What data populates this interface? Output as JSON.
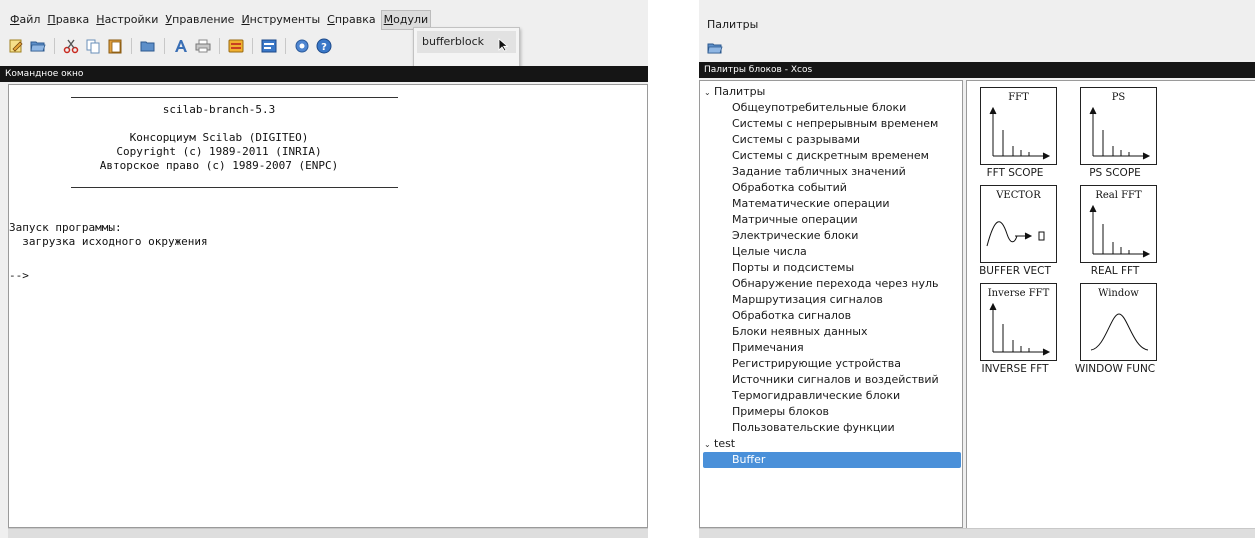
{
  "console_window": {
    "menu": [
      {
        "label": "Файл",
        "mnemonic": "Ф"
      },
      {
        "label": "Правка",
        "mnemonic": "П"
      },
      {
        "label": "Настройки",
        "mnemonic": "Н"
      },
      {
        "label": "Управление",
        "mnemonic": "У"
      },
      {
        "label": "Инструменты",
        "mnemonic": "И"
      },
      {
        "label": "Справка",
        "mnemonic": "С"
      },
      {
        "label": "Модули",
        "mnemonic": "М"
      }
    ],
    "toolbar_icons": [
      "new-script-icon",
      "open-folder-icon",
      "cut-icon",
      "copy-icon",
      "paste-icon",
      "change-directory-icon",
      "font-icon",
      "print-icon",
      "xcos-icon",
      "scinotes-icon",
      "atoms-icon",
      "help-icon"
    ],
    "dropdown_item": "bufferblock",
    "title": "Командное окно",
    "banner": {
      "name": "scilab-branch-5.3",
      "line1": "Консорциум Scilab (DIGITEO)",
      "line2": "Copyright (c) 1989-2011 (INRIA)",
      "line3": "Авторское право (c) 1989-2007 (ENPC)"
    },
    "startup": "Запуск программы:",
    "startup_detail": "  загрузка исходного окружения",
    "prompt": "-->"
  },
  "palette_window": {
    "window_title": "Палитры",
    "title": "Палитры блоков - Xcos",
    "tree": {
      "root_label": "Палитры",
      "children": [
        "Общеупотребительные блоки",
        "Системы с непрерывным временем",
        "Системы с разрывами",
        "Системы с дискретным временем",
        "Задание табличных значений",
        "Обработка событий",
        "Математические операции",
        "Матричные операции",
        "Электрические блоки",
        "Целые числа",
        "Порты и подсистемы",
        "Обнаружение перехода через нуль",
        "Маршрутизация сигналов",
        "Обработка сигналов",
        "Блоки неявных данных",
        "Примечания",
        "Регистрирующие устройства",
        "Источники сигналов и воздействий",
        "Термогидравлические блоки",
        "Примеры блоков",
        "Пользовательские функции"
      ],
      "test_label": "test",
      "test_child": "Buffer"
    },
    "blocks": [
      {
        "caption": "FFT",
        "label": "FFT SCOPE"
      },
      {
        "caption": "PS",
        "label": "PS SCOPE"
      },
      {
        "caption": "VECTOR",
        "label": "BUFFER VECT"
      },
      {
        "caption": "Real FFT",
        "label": "REAL FFT"
      },
      {
        "caption": "Inverse FFT",
        "label": "INVERSE FFT"
      },
      {
        "caption": "Window",
        "label": "WINDOW FUNC"
      }
    ]
  }
}
